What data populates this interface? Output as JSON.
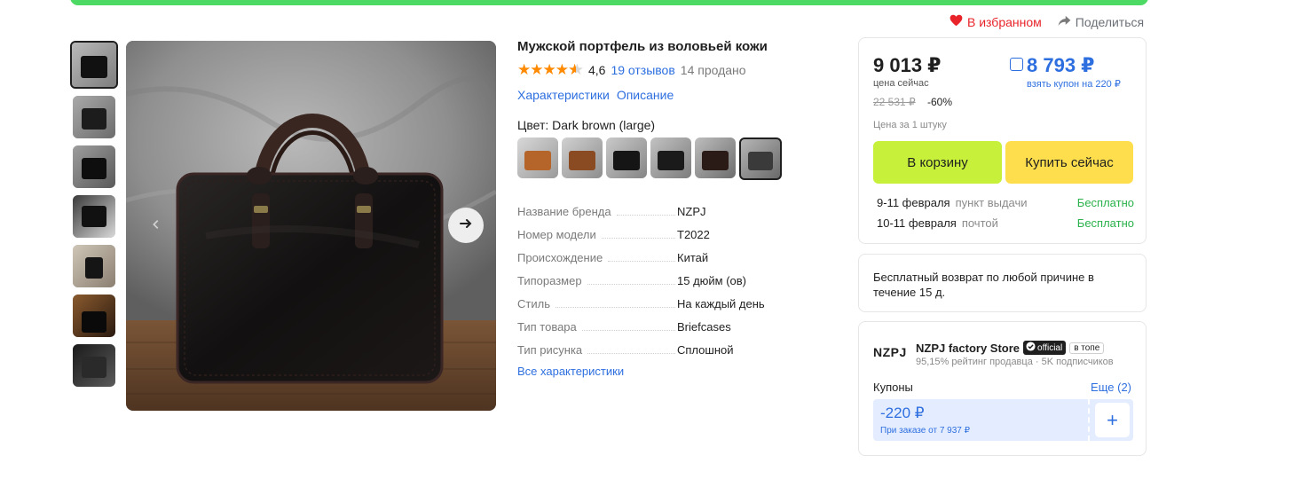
{
  "header": {
    "favorite_label": "В избранном",
    "share_label": "Поделиться"
  },
  "gallery": {
    "thumbnail_count": 7,
    "next_icon": "arrow-right-icon",
    "prev_icon": "arrow-left-icon"
  },
  "product": {
    "title": "Мужской портфель из воловьей кожи",
    "rating": "4,6",
    "reviews": "19 отзывов",
    "sold": "14 продано",
    "tab_specs": "Характеристики",
    "tab_description": "Описание",
    "color_label": "Цвет: Dark brown (large)",
    "swatch_colors": [
      "#b5652a",
      "#8a4a22",
      "#151515",
      "#1a1a1a",
      "#2a1b16",
      "#3a3a3a"
    ],
    "specs": [
      {
        "k": "Название бренда",
        "v": "NZPJ"
      },
      {
        "k": "Номер модели",
        "v": "T2022"
      },
      {
        "k": "Происхождение",
        "v": "Китай"
      },
      {
        "k": "Типоразмер",
        "v": "15 дюйм (ов)"
      },
      {
        "k": "Стиль",
        "v": "На каждый день"
      },
      {
        "k": "Тип товара",
        "v": "Briefcases"
      },
      {
        "k": "Тип рисунка",
        "v": "Сплошной"
      }
    ],
    "all_specs": "Все характеристики"
  },
  "pricing": {
    "price_now": "9 013 ₽",
    "price_now_label": "цена сейчас",
    "coupon_price": "8 793 ₽",
    "coupon_price_label": "взять купон на 220 ₽",
    "old_price": "22 531 ₽",
    "discount": "-60%",
    "unit_price": "Цена за 1 штуку",
    "add_to_cart": "В корзину",
    "buy_now": "Купить сейчас",
    "delivery": [
      {
        "date": "9-11 февраля",
        "how": "пункт выдачи",
        "price": "Бесплатно"
      },
      {
        "date": "10-11 февраля",
        "how": "почтой",
        "price": "Бесплатно"
      }
    ],
    "accent": "#2e6fe0",
    "cart_color": "#c6f03a",
    "buy_color": "#ffde4d"
  },
  "returns": {
    "text": "Бесплатный возврат по любой причине в течение 15 д."
  },
  "store": {
    "logo": "NZPJ",
    "name": "NZPJ factory Store",
    "official": "official",
    "top_badge": "в топе",
    "meta": "95,15% рейтинг продавца  ·  5K подписчиков",
    "coupons_label": "Купоны",
    "coupons_more": "Еще (2)",
    "coupon_amount": "-220 ₽",
    "coupon_condition": "При заказе от 7 937 ₽",
    "coupon_add": "+"
  }
}
